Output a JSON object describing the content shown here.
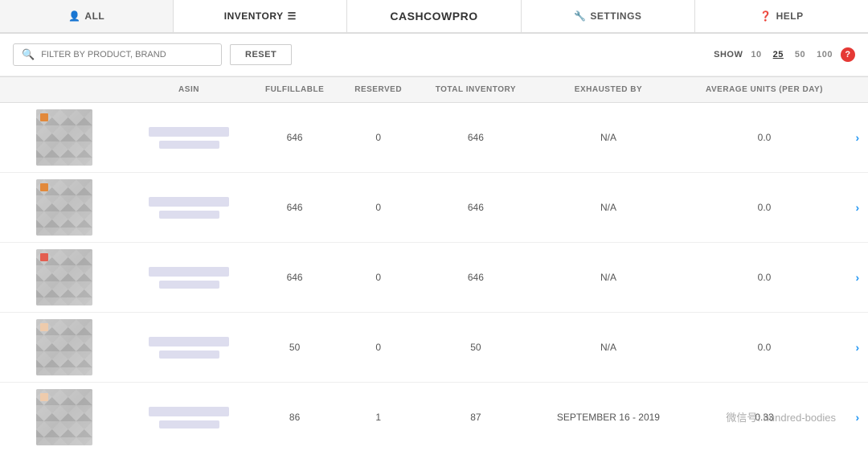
{
  "nav": {
    "items": [
      {
        "id": "all",
        "label": "ALL",
        "icon": "person",
        "active": false
      },
      {
        "id": "inventory",
        "label": "INVENTORY",
        "icon": "list",
        "active": true
      },
      {
        "id": "brand",
        "label": "CASHCOWPRO",
        "icon": "",
        "active": false
      },
      {
        "id": "settings",
        "label": "SETTINGS",
        "icon": "wrench",
        "active": false
      },
      {
        "id": "help",
        "label": "HELP",
        "icon": "question",
        "active": false
      }
    ]
  },
  "filter": {
    "search_placeholder": "FILTER BY PRODUCT, BRAND",
    "reset_label": "RESET",
    "show_label": "SHOW",
    "show_options": [
      "10",
      "25",
      "50",
      "100"
    ],
    "show_active": "25",
    "help_label": "?"
  },
  "table": {
    "columns": [
      {
        "id": "image",
        "label": ""
      },
      {
        "id": "asin",
        "label": "ASIN"
      },
      {
        "id": "fulfillable",
        "label": "FULFILLABLE"
      },
      {
        "id": "reserved",
        "label": "RESERVED"
      },
      {
        "id": "total_inventory",
        "label": "TOTAL INVENTORY"
      },
      {
        "id": "exhausted_by",
        "label": "EXHAUSTED BY"
      },
      {
        "id": "avg_units",
        "label": "AVERAGE UNITS (PER DAY)"
      },
      {
        "id": "action",
        "label": ""
      }
    ],
    "rows": [
      {
        "id": 1,
        "accent_color": "#e67e22",
        "fulfillable": "646",
        "reserved": "0",
        "total_inventory": "646",
        "exhausted_by": "N/A",
        "avg_units": "0.0"
      },
      {
        "id": 2,
        "accent_color": "#e67e22",
        "fulfillable": "646",
        "reserved": "0",
        "total_inventory": "646",
        "exhausted_by": "N/A",
        "avg_units": "0.0"
      },
      {
        "id": 3,
        "accent_color": "#e74c3c",
        "fulfillable": "646",
        "reserved": "0",
        "total_inventory": "646",
        "exhausted_by": "N/A",
        "avg_units": "0.0"
      },
      {
        "id": 4,
        "accent_color": "#f5cba7",
        "fulfillable": "50",
        "reserved": "0",
        "total_inventory": "50",
        "exhausted_by": "N/A",
        "avg_units": "0.0"
      },
      {
        "id": 5,
        "accent_color": "#f5cba7",
        "fulfillable": "86",
        "reserved": "1",
        "total_inventory": "87",
        "exhausted_by": "SEPTEMBER 16 - 2019",
        "avg_units": "0.33"
      }
    ],
    "chevron_label": "›"
  },
  "watermark": "微信号: hundred-bodies"
}
